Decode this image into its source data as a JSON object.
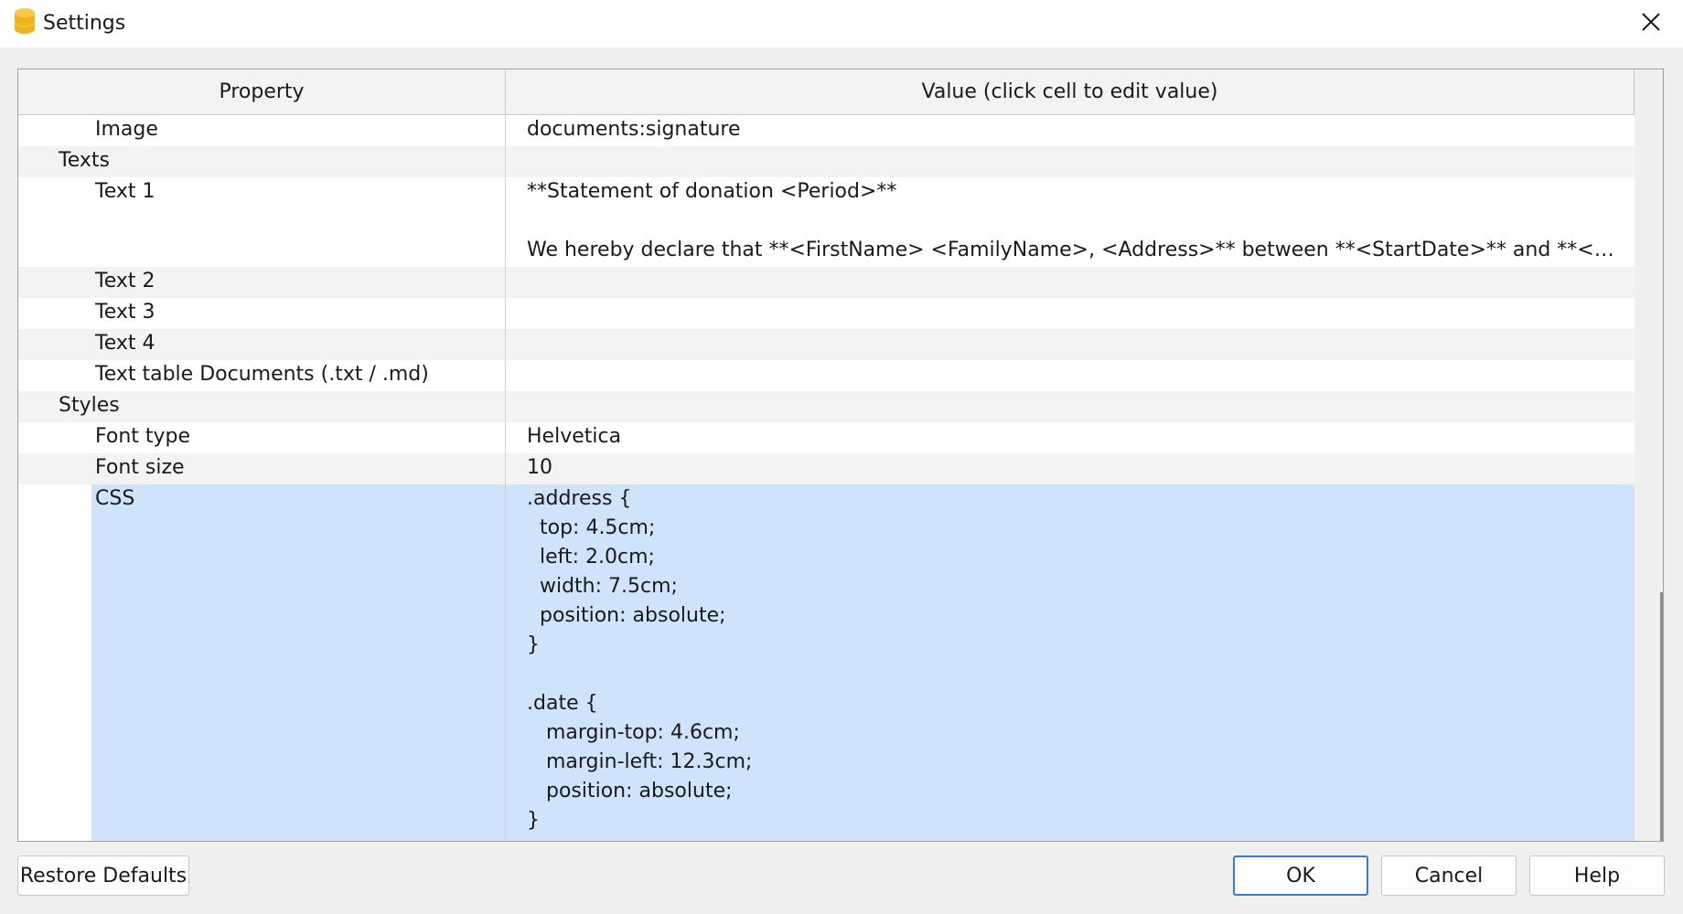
{
  "window": {
    "title": "Settings",
    "app_icon": "banana-database-icon",
    "close_icon": "close-icon"
  },
  "table": {
    "headers": {
      "property": "Property",
      "value": "Value (click cell to edit value)"
    },
    "rows": {
      "image": {
        "label": "Image",
        "value": "documents:signature"
      },
      "texts": {
        "label": "Texts"
      },
      "text1": {
        "label": "Text 1",
        "value": "**Statement of donation <Period>**\n\nWe hereby declare that **<FirstName> <FamilyName>, <Address>** between **<StartDate>** and **<EndDate>** has donated"
      },
      "text2": {
        "label": "Text 2",
        "value": ""
      },
      "text3": {
        "label": "Text 3",
        "value": ""
      },
      "text4": {
        "label": "Text 4",
        "value": ""
      },
      "text_table": {
        "label": "Text table Documents (.txt / .md)",
        "value": ""
      },
      "styles": {
        "label": "Styles"
      },
      "font_type": {
        "label": "Font type",
        "value": "Helvetica"
      },
      "font_size": {
        "label": "Font size",
        "value": "10"
      },
      "css": {
        "label": "CSS",
        "value": ".address {\n  top: 4.5cm;\n  left: 2.0cm;\n  width: 7.5cm;\n  position: absolute;\n}\n\n.date {\n   margin-top: 4.6cm;\n   margin-left: 12.3cm;\n   position: absolute;\n}"
      }
    }
  },
  "buttons": {
    "restore_defaults": "Restore Defaults",
    "ok": "OK",
    "cancel": "Cancel",
    "help": "Help"
  },
  "colors": {
    "selection": "#cfe3fa",
    "primary_border": "#3d7ad0",
    "app_icon": "#f2b41e"
  }
}
